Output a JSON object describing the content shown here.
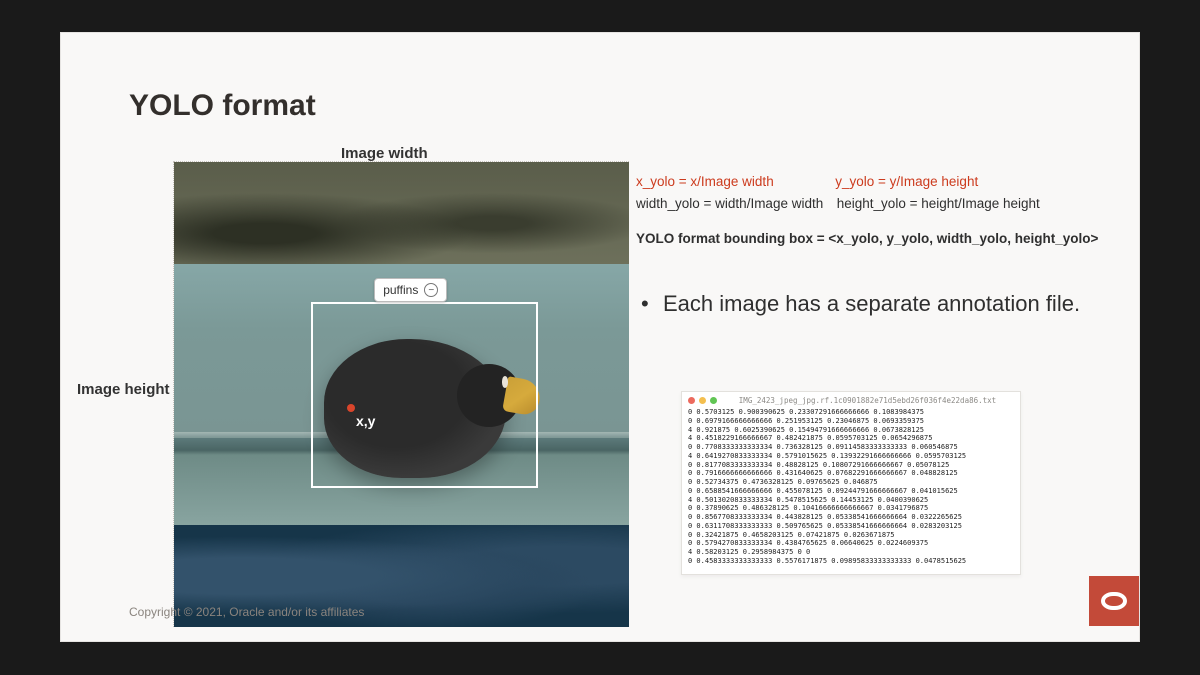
{
  "title": "YOLO format",
  "labels": {
    "image_width": "Image width",
    "image_height": "Image height",
    "xy": "x,y",
    "class_tag": "puffins"
  },
  "formulas": {
    "x_red": "x_yolo = x/Image width",
    "y_red": "y_yolo = y/Image height",
    "w_black": "width_yolo = width/Image width",
    "h_black": "height_yolo = height/Image height",
    "bold": "YOLO format bounding box = <x_yolo, y_yolo, width_yolo, height_yolo>"
  },
  "bullet": "Each image has a separate annotation file.",
  "annotation_file": {
    "filename": "IMG_2423_jpeg_jpg.rf.1c0901882e71d5ebd26f036f4e22da86.txt",
    "rows": [
      [
        0,
        0.5703125,
        0.900390625,
        0.23307291666666666,
        0.1083984375
      ],
      [
        0,
        0.6979166666666666,
        0.251953125,
        0.23046875,
        0.0693359375
      ],
      [
        4,
        0.921875,
        0.6025390625,
        0.15494791666666666,
        0.0673828125
      ],
      [
        4,
        0.4518229166666667,
        0.482421875,
        0.0595703125,
        0.0654296875
      ],
      [
        0,
        0.7708333333333334,
        0.736328125,
        0.09114583333333333,
        0.060546875
      ],
      [
        4,
        0.6419270833333334,
        0.5791015625,
        0.13932291666666666,
        0.0595703125
      ],
      [
        0,
        0.8177083333333334,
        0.48828125,
        0.10807291666666667,
        0.05078125
      ],
      [
        0,
        0.7916666666666666,
        0.431640625,
        0.07682291666666667,
        0.048828125
      ],
      [
        0,
        0.52734375,
        0.4736328125,
        0.09765625,
        0.046875
      ],
      [
        0,
        0.6588541666666666,
        0.455078125,
        0.09244791666666667,
        0.041015625
      ],
      [
        4,
        0.5013020833333334,
        0.5478515625,
        0.14453125,
        0.0400390625
      ],
      [
        0,
        0.37890625,
        0.486328125,
        0.10416666666666667,
        0.0341796875
      ],
      [
        0,
        0.8567708333333334,
        0.443828125,
        0.05338541666666664,
        0.0322265625
      ],
      [
        0,
        0.6311708333333333,
        0.509765625,
        0.05338541666666664,
        0.0283203125
      ],
      [
        0,
        0.32421875,
        0.4658203125,
        0.07421875,
        0.0263671875
      ],
      [
        0,
        0.5794270833333334,
        0.4384765625,
        0.06640625,
        0.0224609375
      ],
      [
        4,
        0.58203125,
        0.2958984375,
        0,
        0
      ],
      [
        0,
        0.4583333333333333,
        0.5576171875,
        0.09895833333333333,
        0.0478515625
      ]
    ]
  },
  "copyright": "Copyright © 2021, Oracle and/or its affiliates"
}
